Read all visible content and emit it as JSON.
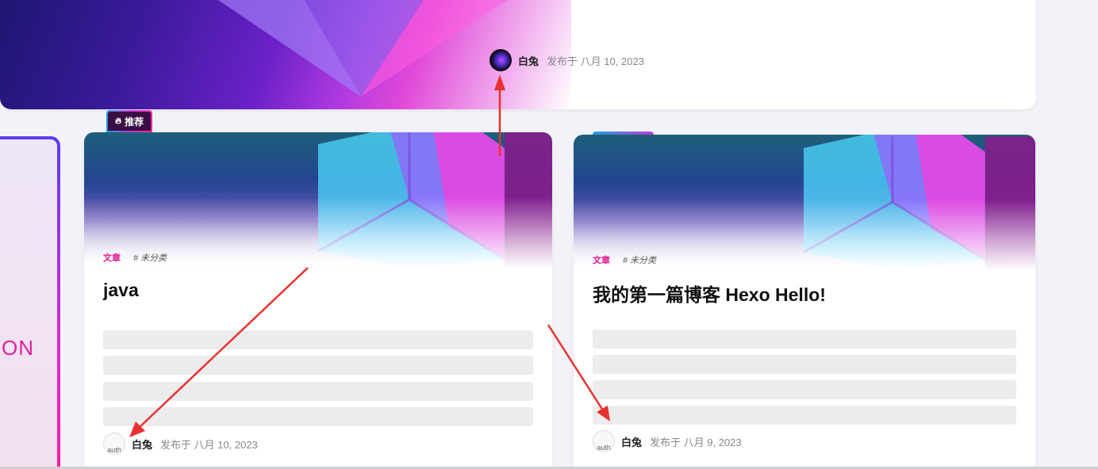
{
  "hero": {
    "author": "白兔",
    "date": "发布于 八月 10, 2023"
  },
  "left_card": {
    "text": "ON"
  },
  "badge": {
    "icon": "flame-icon",
    "label": "推荐"
  },
  "posts": [
    {
      "category": "文章",
      "tag": "# 未分类",
      "title": "java",
      "author": "白兔",
      "date": "发布于 八月 10, 2023",
      "avatar_alt": "auth"
    },
    {
      "category": "文章",
      "tag": "# 未分类",
      "title": "我的第一篇博客 Hexo Hello!",
      "author": "白兔",
      "date": "发布于 八月 9, 2023",
      "avatar_alt": "auth"
    }
  ],
  "colors": {
    "accent": "#e0188f",
    "arrow": "#e8322f",
    "background": "#f2f3f8"
  }
}
